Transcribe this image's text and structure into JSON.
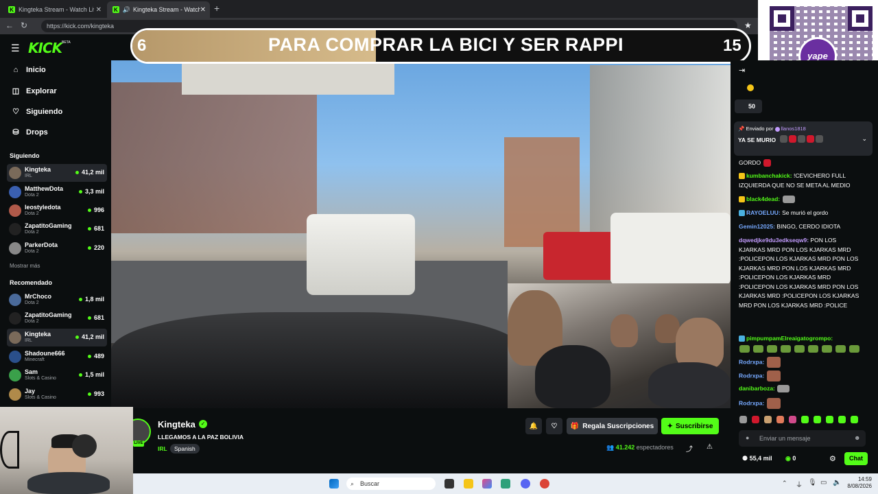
{
  "browser": {
    "tabs": [
      {
        "title": "Kingteka Stream - Watch Live on K"
      },
      {
        "title": "Kingteka Stream - Watch Live"
      }
    ],
    "url": "https://kick.com/kingteka"
  },
  "header": {
    "logo": "KICK",
    "beta": "BETA"
  },
  "sidebar": {
    "nav": [
      {
        "label": "Inicio",
        "icon": "home-icon"
      },
      {
        "label": "Explorar",
        "icon": "compass-icon"
      },
      {
        "label": "Siguiendo",
        "icon": "heart-icon"
      },
      {
        "label": "Drops",
        "icon": "drops-icon"
      }
    ],
    "following_title": "Siguiendo",
    "following": [
      {
        "name": "Kingteka",
        "category": "IRL",
        "viewers": "41,2 mil",
        "selected": true
      },
      {
        "name": "MatthewDota",
        "category": "Dota 2",
        "viewers": "3,3 mil"
      },
      {
        "name": "leostyledota",
        "category": "Dota 2",
        "viewers": "996"
      },
      {
        "name": "ZapatitoGaming",
        "category": "Dota 2",
        "viewers": "681"
      },
      {
        "name": "ParkerDota",
        "category": "Dota 2",
        "viewers": "220"
      }
    ],
    "show_more": "Mostrar más",
    "recommended_title": "Recomendado",
    "recommended": [
      {
        "name": "MrChoco",
        "category": "Dota 2",
        "viewers": "1,8 mil"
      },
      {
        "name": "ZapatitoGaming",
        "category": "Dota 2",
        "viewers": "681"
      },
      {
        "name": "Kingteka",
        "category": "IRL",
        "viewers": "41,2 mil",
        "selected": true
      },
      {
        "name": "Shadoune666",
        "category": "Minecraft",
        "viewers": "489"
      },
      {
        "name": "Sam",
        "category": "Slots & Casino",
        "viewers": "1,5 mil"
      },
      {
        "name": "Jay",
        "category": "Slots & Casino",
        "viewers": "993"
      }
    ]
  },
  "banner": {
    "left_number": "6",
    "text": "PARA COMPRAR LA BICI Y SER RAPPI",
    "right_number": "15",
    "progress": 0.4
  },
  "qr": {
    "brand": "yape"
  },
  "stream": {
    "channel": "Kingteka",
    "title": "LLEGAMOS A LA PAZ BOLIVIA",
    "category": "IRL",
    "language": "Spanish",
    "viewers": "41.242",
    "viewers_label": "espectadores",
    "live": "LIVE",
    "gift_label": "Regala Suscripciones",
    "subscribe_label": "Suscribirse"
  },
  "chat": {
    "top_count": "50",
    "pinned_by_label": "Enviado por",
    "pinned_user": "llanos1818",
    "pinned_text": "YA SE MURIO",
    "messages": [
      {
        "user": "",
        "text": "GORDO",
        "color": "#ffffff"
      },
      {
        "user": "kumbanchakick:",
        "text": "!CEVICHERO FULL IZQUIERDA QUE NO SE META AL MEDIO",
        "color": "#53fc18"
      },
      {
        "user": "black4dead:",
        "text": "",
        "color": "#53fc18"
      },
      {
        "user": "RAYOELUU:",
        "text": "Se murió el gordo",
        "color": "#76a9ff"
      },
      {
        "user": "Gemin12025:",
        "text": "BINGO, CERDO IDIOTA",
        "color": "#76a9ff"
      },
      {
        "user": "dqwedjke9du3edkseqw9:",
        "text": "PON LOS KJARKAS MRD  PON LOS KJARKAS MRD :POLICEPON LOS KJARKAS MRD  PON LOS KJARKAS MRD  PON LOS KJARKAS MRD :POLICEPON LOS KJARKAS MRD :POLICEPON LOS KJARKAS MRD  PON LOS KJARKAS MRD :POLICEPON LOS KJARKAS MRD  PON LOS KJARKAS MRD :POLICE",
        "color": "#c39cff"
      },
      {
        "user": "pimpumpamElreaigatogrompo:",
        "text": "",
        "color": "#53fc18"
      },
      {
        "user": "Rodrxpa:",
        "text": "",
        "color": "#76a9ff"
      },
      {
        "user": "Rodrxpa:",
        "text": "",
        "color": "#76a9ff"
      },
      {
        "user": "danibarboza:",
        "text": "",
        "color": "#53fc18"
      },
      {
        "user": "Rodrxpa:",
        "text": "",
        "color": "#76a9ff"
      }
    ],
    "input_placeholder": "Enviar un mensaje",
    "points": "55,4 mil",
    "kick_points": "0",
    "send_label": "Chat"
  },
  "taskbar": {
    "search": "Buscar",
    "time": "14:59",
    "date": "8/08/2026"
  },
  "colors": {
    "accent": "#53fc18",
    "bg": "#0b0e0f"
  }
}
